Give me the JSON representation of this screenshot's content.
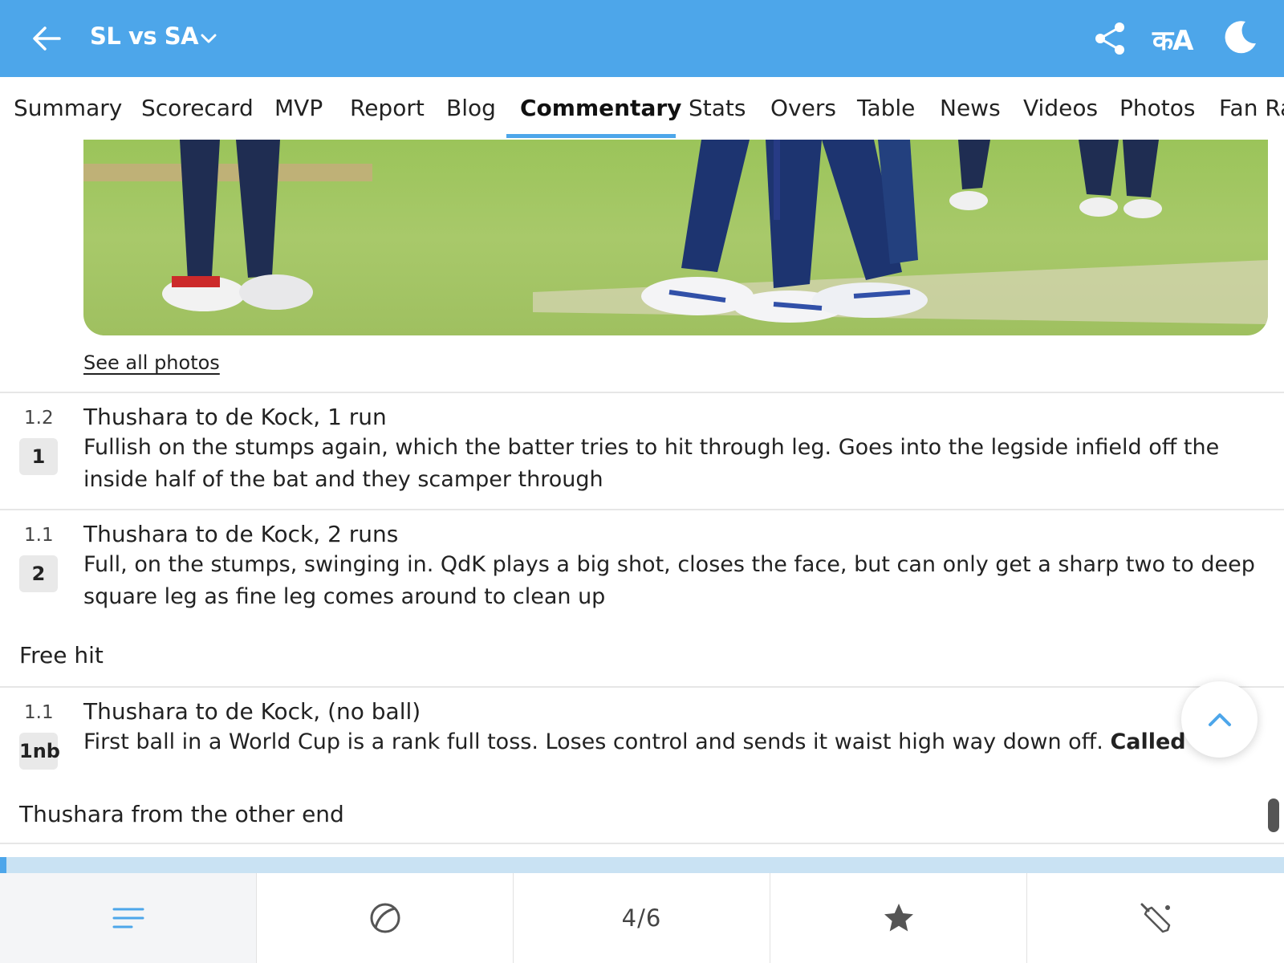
{
  "header": {
    "title": "SL vs SA",
    "lang_label": "कA",
    "bg_color": "#4da6ea"
  },
  "tabs": [
    {
      "label": "Summary"
    },
    {
      "label": "Scorecard"
    },
    {
      "label": "MVP"
    },
    {
      "label": "Report"
    },
    {
      "label": "Blog"
    },
    {
      "label": "Commentary",
      "active": true
    },
    {
      "label": "Stats"
    },
    {
      "label": "Overs"
    },
    {
      "label": "Table"
    },
    {
      "label": "News"
    },
    {
      "label": "Videos"
    },
    {
      "label": "Photos"
    },
    {
      "label": "Fan Ra"
    }
  ],
  "photo": {
    "see_all_label": "See all photos"
  },
  "commentary": [
    {
      "ball": "1.2",
      "runs": "1",
      "headline": "Thushara to de Kock, 1 run",
      "text": "Fullish on the stumps again, which the batter tries to hit through leg. Goes into the legside infield off the inside half of the bat and they scamper through"
    },
    {
      "ball": "1.1",
      "runs": "2",
      "headline": "Thushara to de Kock, 2 runs",
      "text": "Full, on the stumps, swinging in. QdK plays a big shot, closes the face, but can only get a sharp two to deep square leg as fine leg comes around to clean up"
    },
    {
      "note": "Free hit"
    },
    {
      "ball": "1.1",
      "runs": "1nb",
      "headline": "Thushara to de Kock, (no ball)",
      "text": "First ball in a World Cup is a rank full toss. Loses control and sends it waist high way down off. ",
      "text_bold": "Called a no b"
    },
    {
      "note": "Thushara from the other end"
    }
  ],
  "progress": {
    "fraction": 0.005
  },
  "bottom_nav": {
    "items": [
      {
        "icon": "menu-lines-icon",
        "active": true
      },
      {
        "icon": "cricket-ball-icon"
      },
      {
        "label": "4/6"
      },
      {
        "icon": "star-icon"
      },
      {
        "icon": "cricket-bat-icon"
      }
    ]
  }
}
